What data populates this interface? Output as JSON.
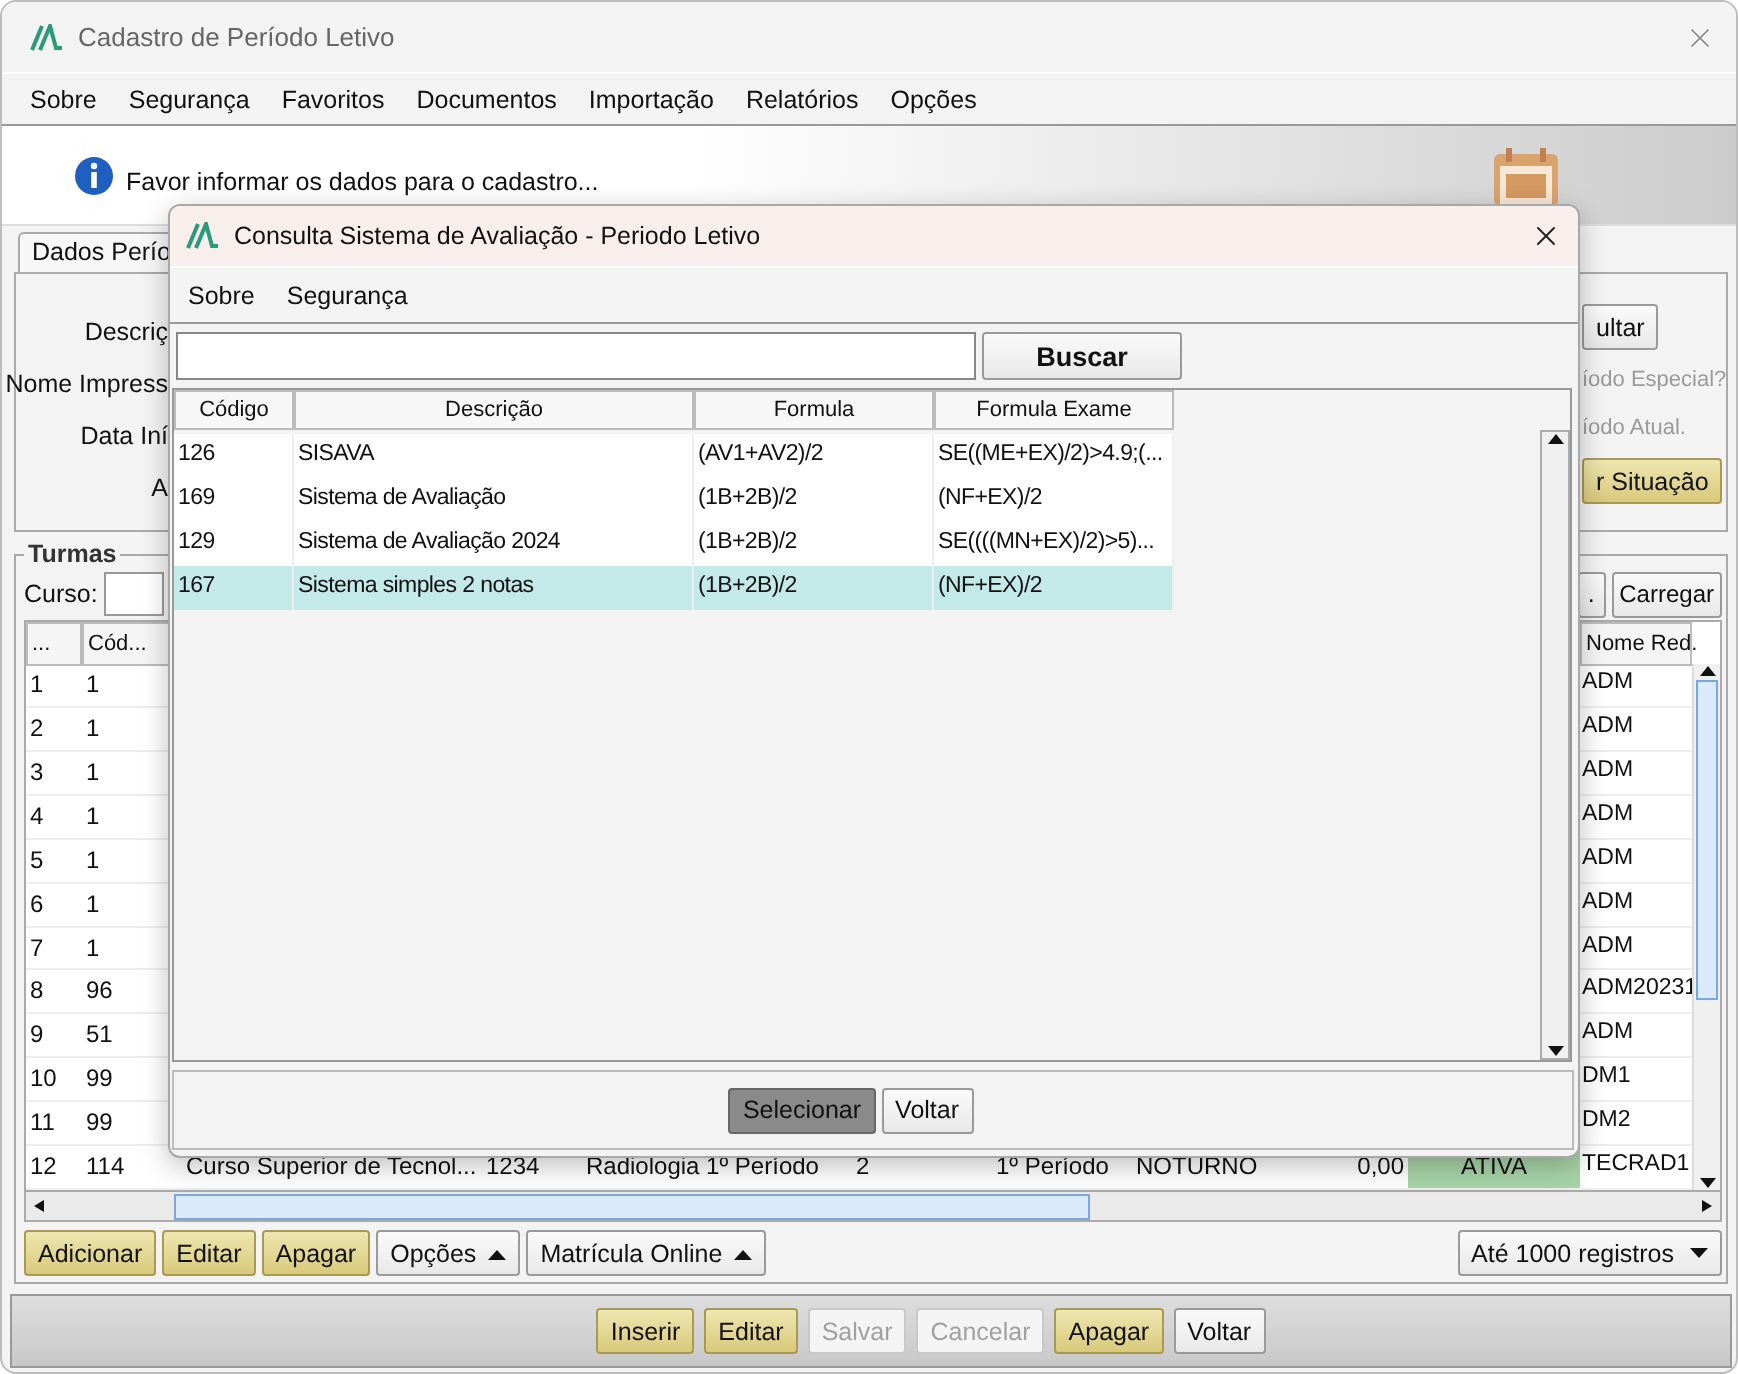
{
  "window": {
    "title": "Cadastro de Período Letivo"
  },
  "menu": [
    "Sobre",
    "Segurança",
    "Favoritos",
    "Documentos",
    "Importação",
    "Relatórios",
    "Opções"
  ],
  "info": "Favor informar os dados para o cadastro...",
  "tab": {
    "label": "Dados Perío",
    "selected": true
  },
  "form": {
    "labels": [
      "Descriç",
      "Nome Impress",
      "Data Iní",
      "A"
    ],
    "right": [
      {
        "kind": "button",
        "label": "ultar",
        "disabled": false
      },
      {
        "kind": "check",
        "label": "íodo Especial?",
        "disabled": true
      },
      {
        "kind": "check",
        "label": "íodo Atual.",
        "disabled": true
      },
      {
        "kind": "highlighted",
        "label": "r Situação",
        "disabled": false
      }
    ]
  },
  "turmas": {
    "title": "Turmas",
    "curso_label": "Curso:",
    "buttons": [
      {
        "label": ".",
        "disabled": false
      },
      {
        "label": "Carregar",
        "disabled": false
      }
    ],
    "columns": [
      "...",
      "Cód...",
      "Nome Red."
    ],
    "rows": [
      {
        "num": "1",
        "cod": "1",
        "nome": "ADM"
      },
      {
        "num": "2",
        "cod": "1",
        "nome": "ADM"
      },
      {
        "num": "3",
        "cod": "1",
        "nome": "ADM"
      },
      {
        "num": "4",
        "cod": "1",
        "nome": "ADM"
      },
      {
        "num": "5",
        "cod": "1",
        "nome": "ADM"
      },
      {
        "num": "6",
        "cod": "1",
        "nome": "ADM"
      },
      {
        "num": "7",
        "cod": "1",
        "nome": "ADM"
      },
      {
        "num": "8",
        "cod": "96",
        "nome": "ADM20231"
      },
      {
        "num": "9",
        "cod": "51",
        "nome": "ADM"
      },
      {
        "num": "10",
        "cod": "99",
        "nome": "DM1"
      },
      {
        "num": "11",
        "cod": "99",
        "nome": "DM2"
      },
      {
        "num": "12",
        "cod": "114",
        "middle": [
          "Curso Superior de Tecnol...",
          "1234",
          "Radiologia 1º Período",
          "2",
          "1º Período",
          "NOTURNO",
          "0,00"
        ],
        "status": "ATIVA",
        "nome": "TECRAD1"
      }
    ],
    "actions": [
      {
        "label": "Adicionar",
        "kind": "highlighted",
        "disabled": false,
        "menu": false
      },
      {
        "label": "Editar",
        "kind": "highlighted",
        "disabled": false,
        "menu": false
      },
      {
        "label": "Apagar",
        "kind": "highlighted",
        "disabled": false,
        "menu": false
      },
      {
        "label": "Opções",
        "kind": "normal",
        "disabled": false,
        "menu": true
      },
      {
        "label": "Matrícula Online",
        "kind": "normal",
        "disabled": false,
        "menu": true
      }
    ],
    "limit": "Até 1000 registros"
  },
  "footer": [
    {
      "label": "Inserir",
      "kind": "highlighted",
      "disabled": false
    },
    {
      "label": "Editar",
      "kind": "highlighted",
      "disabled": false
    },
    {
      "label": "Salvar",
      "kind": "normal",
      "disabled": true
    },
    {
      "label": "Cancelar",
      "kind": "normal",
      "disabled": true
    },
    {
      "label": "Apagar",
      "kind": "highlighted",
      "disabled": false
    },
    {
      "label": "Voltar",
      "kind": "normal",
      "disabled": false
    }
  ],
  "dialog": {
    "title": "Consulta Sistema de Avaliação - Periodo Letivo",
    "menu": [
      "Sobre",
      "Segurança"
    ],
    "search_button": "Buscar",
    "columns": [
      "Código",
      "Descrição",
      "Formula",
      "Formula Exame"
    ],
    "rows": [
      {
        "cells": [
          "126",
          "SISAVA",
          "(AV1+AV2)/2",
          "SE((ME+EX)/2)>4.9;(..."
        ],
        "selected": false
      },
      {
        "cells": [
          "169",
          "Sistema de Avaliação",
          "(1B+2B)/2",
          "(NF+EX)/2"
        ],
        "selected": false
      },
      {
        "cells": [
          "129",
          "Sistema de Avaliação 2024",
          "(1B+2B)/2",
          "SE((((MN+EX)/2)>5)..."
        ],
        "selected": false
      },
      {
        "cells": [
          "167",
          "Sistema simples 2 notas",
          "(1B+2B)/2",
          "(NF+EX)/2"
        ],
        "selected": true
      }
    ],
    "buttons": [
      {
        "label": "Selecionar",
        "kind": "default",
        "disabled": false
      },
      {
        "label": "Voltar",
        "kind": "normal",
        "disabled": false
      }
    ]
  }
}
